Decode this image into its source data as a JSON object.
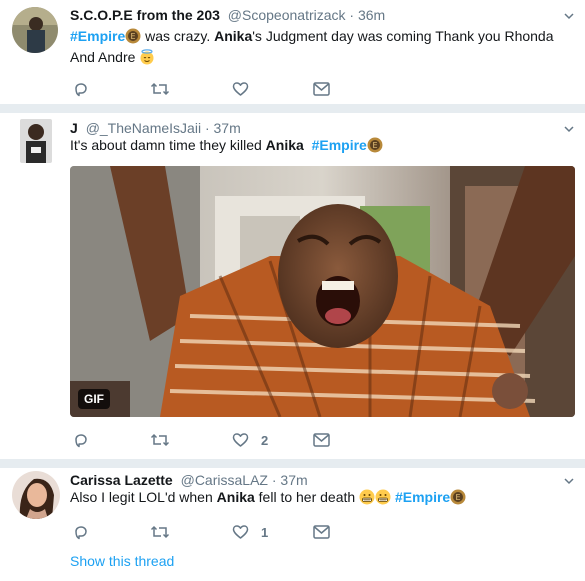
{
  "tweets": [
    {
      "name": "S.C.O.P.E from the 203",
      "handle": "@Scopeonatrizack",
      "dot": "·",
      "time": "36m",
      "text": {
        "tag": "#Empire",
        "t1": " was crazy. ",
        "bold": "Anika",
        "t2": "'s Judgment day was coming Thank you Rhonda And Andre "
      },
      "reply_count": "",
      "retweet_count": "",
      "like_count": ""
    },
    {
      "name": "J",
      "handle": "@_TheNameIsJaii",
      "dot": "·",
      "time": "37m",
      "text": {
        "t1": "It's about damn time they killed ",
        "bold": "Anika",
        "tag": "#Empire"
      },
      "media_badge": "GIF",
      "reply_count": "",
      "retweet_count": "",
      "like_count": "2"
    },
    {
      "name": "Carissa Lazette",
      "handle": "@CarissaLAZ",
      "dot": "·",
      "time": "37m",
      "text": {
        "t1": "Also I legit LOL'd when ",
        "bold": "Anika",
        "t2": " fell to her death ",
        "tag": "#Empire"
      },
      "reply_count": "",
      "retweet_count": "",
      "like_count": "1",
      "show_thread": "Show this thread"
    }
  ],
  "colors": {
    "link": "#1da1f2",
    "muted": "#657786",
    "separator": "#e6ecf0"
  },
  "icons": [
    "reply-icon",
    "retweet-icon",
    "like-icon",
    "message-icon",
    "chevron-down-icon",
    "empire-emoji",
    "angel-emoji",
    "grimace-emoji"
  ]
}
